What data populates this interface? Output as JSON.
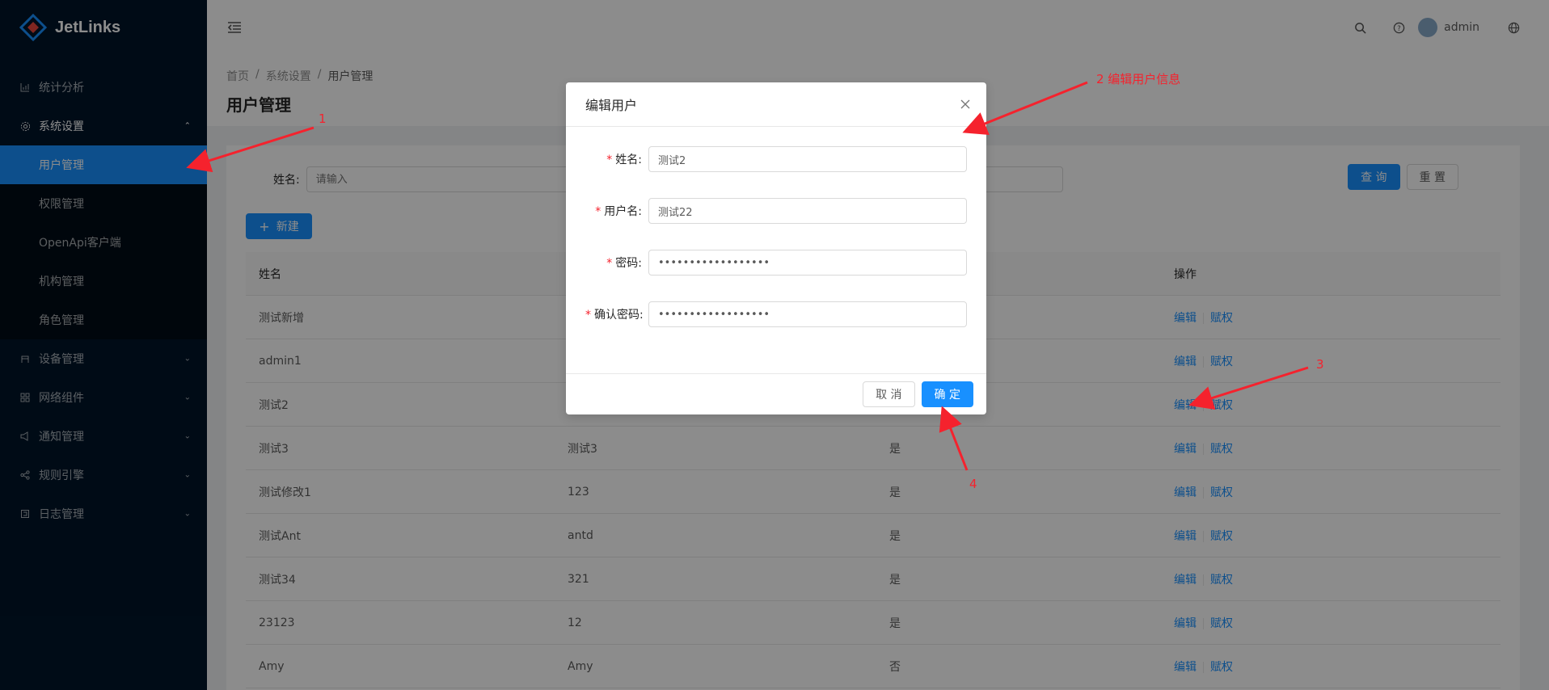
{
  "app": {
    "name": "JetLinks"
  },
  "sidebar": {
    "items": [
      {
        "label": "统计分析",
        "icon": "bar-chart-icon"
      },
      {
        "label": "系统设置",
        "icon": "setting-icon",
        "expanded": true,
        "children": [
          {
            "label": "用户管理",
            "active": true
          },
          {
            "label": "权限管理"
          },
          {
            "label": "OpenApi客户端"
          },
          {
            "label": "机构管理"
          },
          {
            "label": "角色管理"
          }
        ]
      },
      {
        "label": "设备管理",
        "icon": "device-icon"
      },
      {
        "label": "网络组件",
        "icon": "appstore-icon"
      },
      {
        "label": "通知管理",
        "icon": "notification-icon"
      },
      {
        "label": "规则引擎",
        "icon": "share-icon"
      },
      {
        "label": "日志管理",
        "icon": "log-icon"
      }
    ]
  },
  "header": {
    "username": "admin"
  },
  "breadcrumb": [
    "首页",
    "系统设置",
    "用户管理"
  ],
  "page_title": "用户管理",
  "search": {
    "label": "姓名:",
    "placeholder": "请输入",
    "query_label": "查 询",
    "reset_label": "重 置"
  },
  "new_button": "新建",
  "table": {
    "columns": [
      "姓名",
      "",
      "",
      "操作"
    ],
    "rows": [
      {
        "name": "测试新增",
        "username": "",
        "status": "",
        "edit": "编辑",
        "grant": "赋权"
      },
      {
        "name": "admin1",
        "username": "",
        "status": "",
        "edit": "编辑",
        "grant": "赋权"
      },
      {
        "name": "测试2",
        "username": "",
        "status": "",
        "edit": "编辑",
        "grant": "赋权"
      },
      {
        "name": "测试3",
        "username": "测试3",
        "status": "是",
        "edit": "编辑",
        "grant": "赋权"
      },
      {
        "name": "测试修改1",
        "username": "123",
        "status": "是",
        "edit": "编辑",
        "grant": "赋权"
      },
      {
        "name": "测试Ant",
        "username": "antd",
        "status": "是",
        "edit": "编辑",
        "grant": "赋权"
      },
      {
        "name": "测试34",
        "username": "321",
        "status": "是",
        "edit": "编辑",
        "grant": "赋权"
      },
      {
        "name": "23123",
        "username": "12",
        "status": "是",
        "edit": "编辑",
        "grant": "赋权"
      },
      {
        "name": "Amy",
        "username": "Amy",
        "status": "否",
        "edit": "编辑",
        "grant": "赋权"
      }
    ]
  },
  "modal": {
    "title": "编辑用户",
    "fields": [
      {
        "label": "姓名:",
        "value": "测试2"
      },
      {
        "label": "用户名:",
        "value": "测试22"
      },
      {
        "label": "密码:",
        "value": "••••••••••••••••••"
      },
      {
        "label": "确认密码:",
        "value": "••••••••••••••••••"
      }
    ],
    "cancel_label": "取 消",
    "ok_label": "确 定"
  },
  "annotations": [
    "1",
    "2 编辑用户信息",
    "3",
    "4"
  ],
  "colors": {
    "primary": "#1890ff",
    "sider": "#001529",
    "annotation": "#f5222d"
  }
}
